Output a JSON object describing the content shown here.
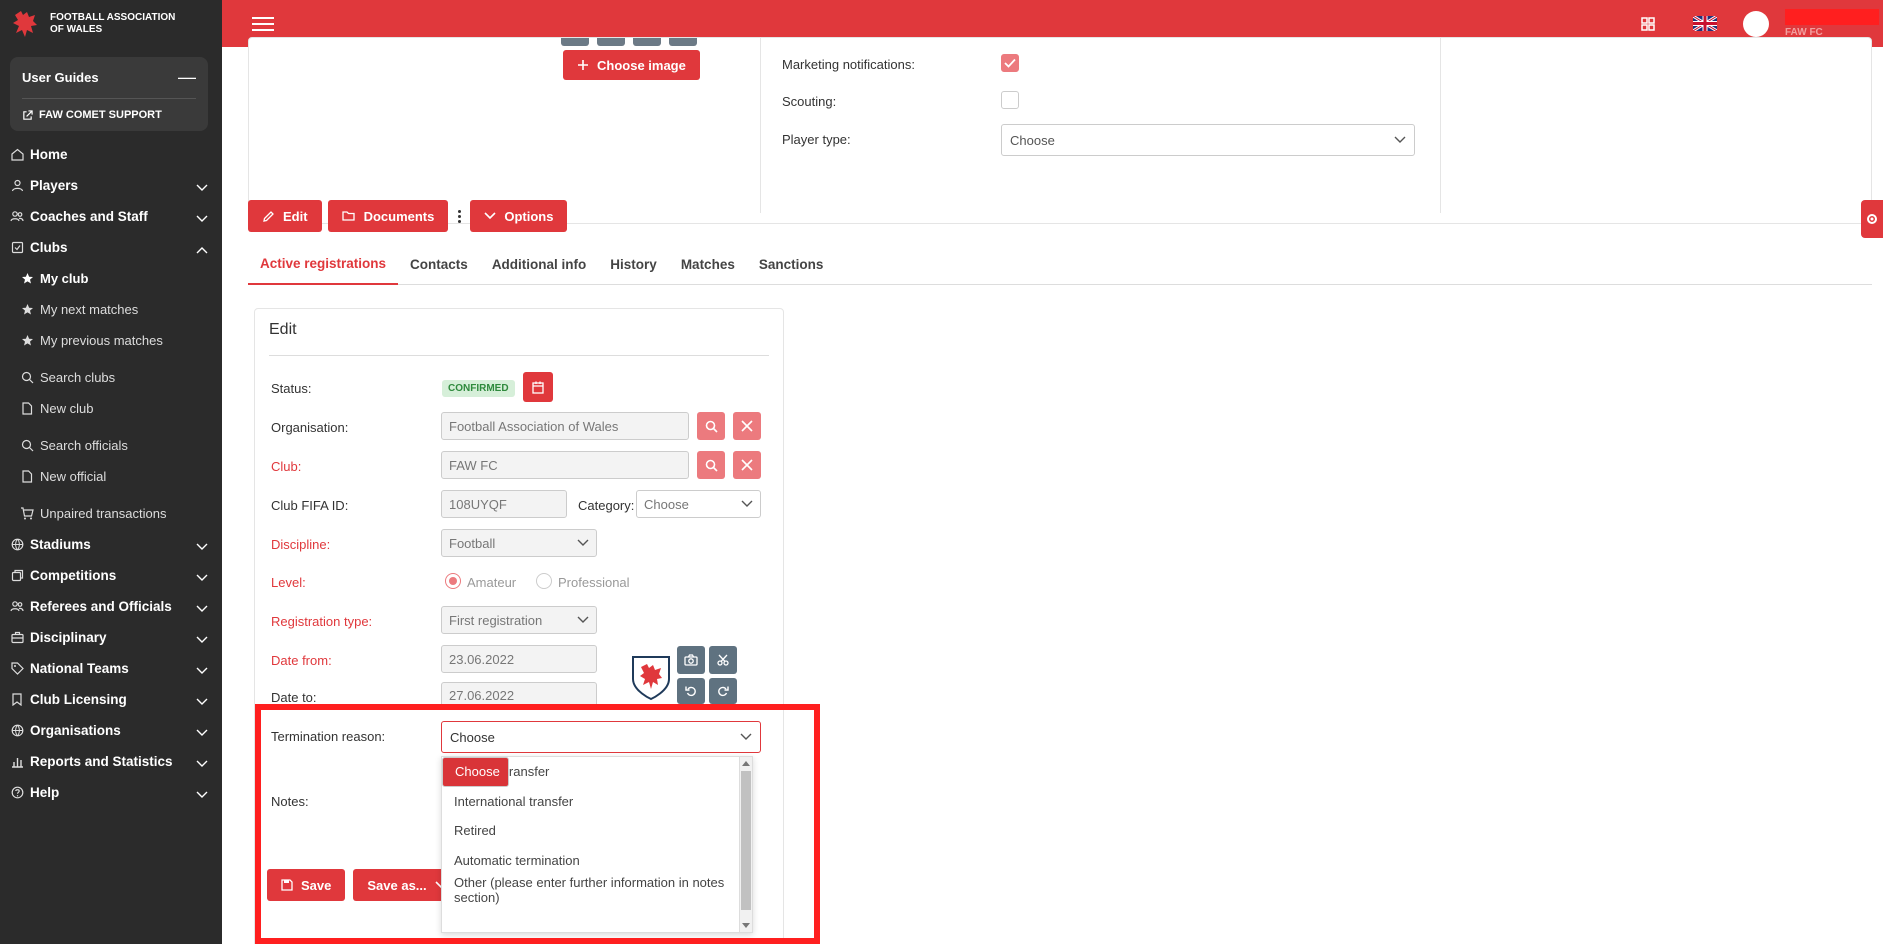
{
  "brand": {
    "name": "FOOTBALL ASSOCIATION OF WALES"
  },
  "guides": {
    "title": "User Guides",
    "collapse": "—",
    "support": "FAW COMET SUPPORT"
  },
  "nav": [
    {
      "label": "Home",
      "icon": "home-icon"
    },
    {
      "label": "Players",
      "icon": "person-icon",
      "chevron": true
    },
    {
      "label": "Coaches and Staff",
      "icon": "people-icon",
      "chevron": true
    },
    {
      "label": "Clubs",
      "icon": "shield-icon",
      "chevron": true,
      "expanded": true
    },
    {
      "label": "My club",
      "icon": "star-icon",
      "sub": true,
      "active": true
    },
    {
      "label": "My next matches",
      "icon": "star-icon",
      "sub": true
    },
    {
      "label": "My previous matches",
      "icon": "star-icon",
      "sub": true
    },
    {
      "label": "Search clubs",
      "icon": "search-icon",
      "sub": true,
      "gap": true
    },
    {
      "label": "New club",
      "icon": "file-icon",
      "sub": true
    },
    {
      "label": "Search officials",
      "icon": "search-icon",
      "sub": true,
      "gap": true
    },
    {
      "label": "New official",
      "icon": "file-icon",
      "sub": true
    },
    {
      "label": "Unpaired transactions",
      "icon": "cart-icon",
      "sub": true,
      "gap": true
    },
    {
      "label": "Stadiums",
      "icon": "globe-icon",
      "chevron": true
    },
    {
      "label": "Competitions",
      "icon": "copy-icon",
      "chevron": true
    },
    {
      "label": "Referees and Officials",
      "icon": "people-icon",
      "chevron": true
    },
    {
      "label": "Disciplinary",
      "icon": "briefcase-icon",
      "chevron": true
    },
    {
      "label": "National Teams",
      "icon": "tag-icon",
      "chevron": true
    },
    {
      "label": "Club Licensing",
      "icon": "bookmark-icon",
      "chevron": true
    },
    {
      "label": "Organisations",
      "icon": "globe-icon",
      "chevron": true
    },
    {
      "label": "Reports and Statistics",
      "icon": "chart-icon",
      "chevron": true
    },
    {
      "label": "Help",
      "icon": "help-icon",
      "chevron": true
    }
  ],
  "topbar": {
    "club": "FAW FC"
  },
  "profile": {
    "choose_image": "Choose image",
    "marketing_label": "Marketing notifications:",
    "scouting_label": "Scouting:",
    "player_type_label": "Player type:",
    "player_type_value": "Choose"
  },
  "toolbar": {
    "edit": "Edit",
    "documents": "Documents",
    "options": "Options"
  },
  "tabs": [
    "Active registrations",
    "Contacts",
    "Additional info",
    "History",
    "Matches",
    "Sanctions"
  ],
  "edit": {
    "title": "Edit",
    "status_label": "Status:",
    "status_value": "CONFIRMED",
    "organisation_label": "Organisation:",
    "organisation_value": "Football Association of Wales",
    "club_label": "Club:",
    "club_value": "FAW FC",
    "fifa_label": "Club FIFA ID:",
    "fifa_value": "108UYQF",
    "category_label": "Category:",
    "category_value": "Choose",
    "discipline_label": "Discipline:",
    "discipline_value": "Football",
    "level_label": "Level:",
    "level_amateur": "Amateur",
    "level_professional": "Professional",
    "regtype_label": "Registration type:",
    "regtype_value": "First registration",
    "date_from_label": "Date from:",
    "date_from_value": "23.06.2022",
    "date_to_label": "Date to:",
    "date_to_value": "27.06.2022",
    "termination_label": "Termination reason:",
    "termination_value": "Choose",
    "notes_label": "Notes:",
    "save": "Save",
    "save_as": "Save as..."
  },
  "termination_options": [
    "Choose",
    "National transfer",
    "International transfer",
    "Retired",
    "Automatic termination",
    "Other (please enter further information in notes section)"
  ],
  "colors": {
    "accent": "#e0383c",
    "sidebar": "#2b2b2b",
    "highlight": "#ff1f1f"
  }
}
